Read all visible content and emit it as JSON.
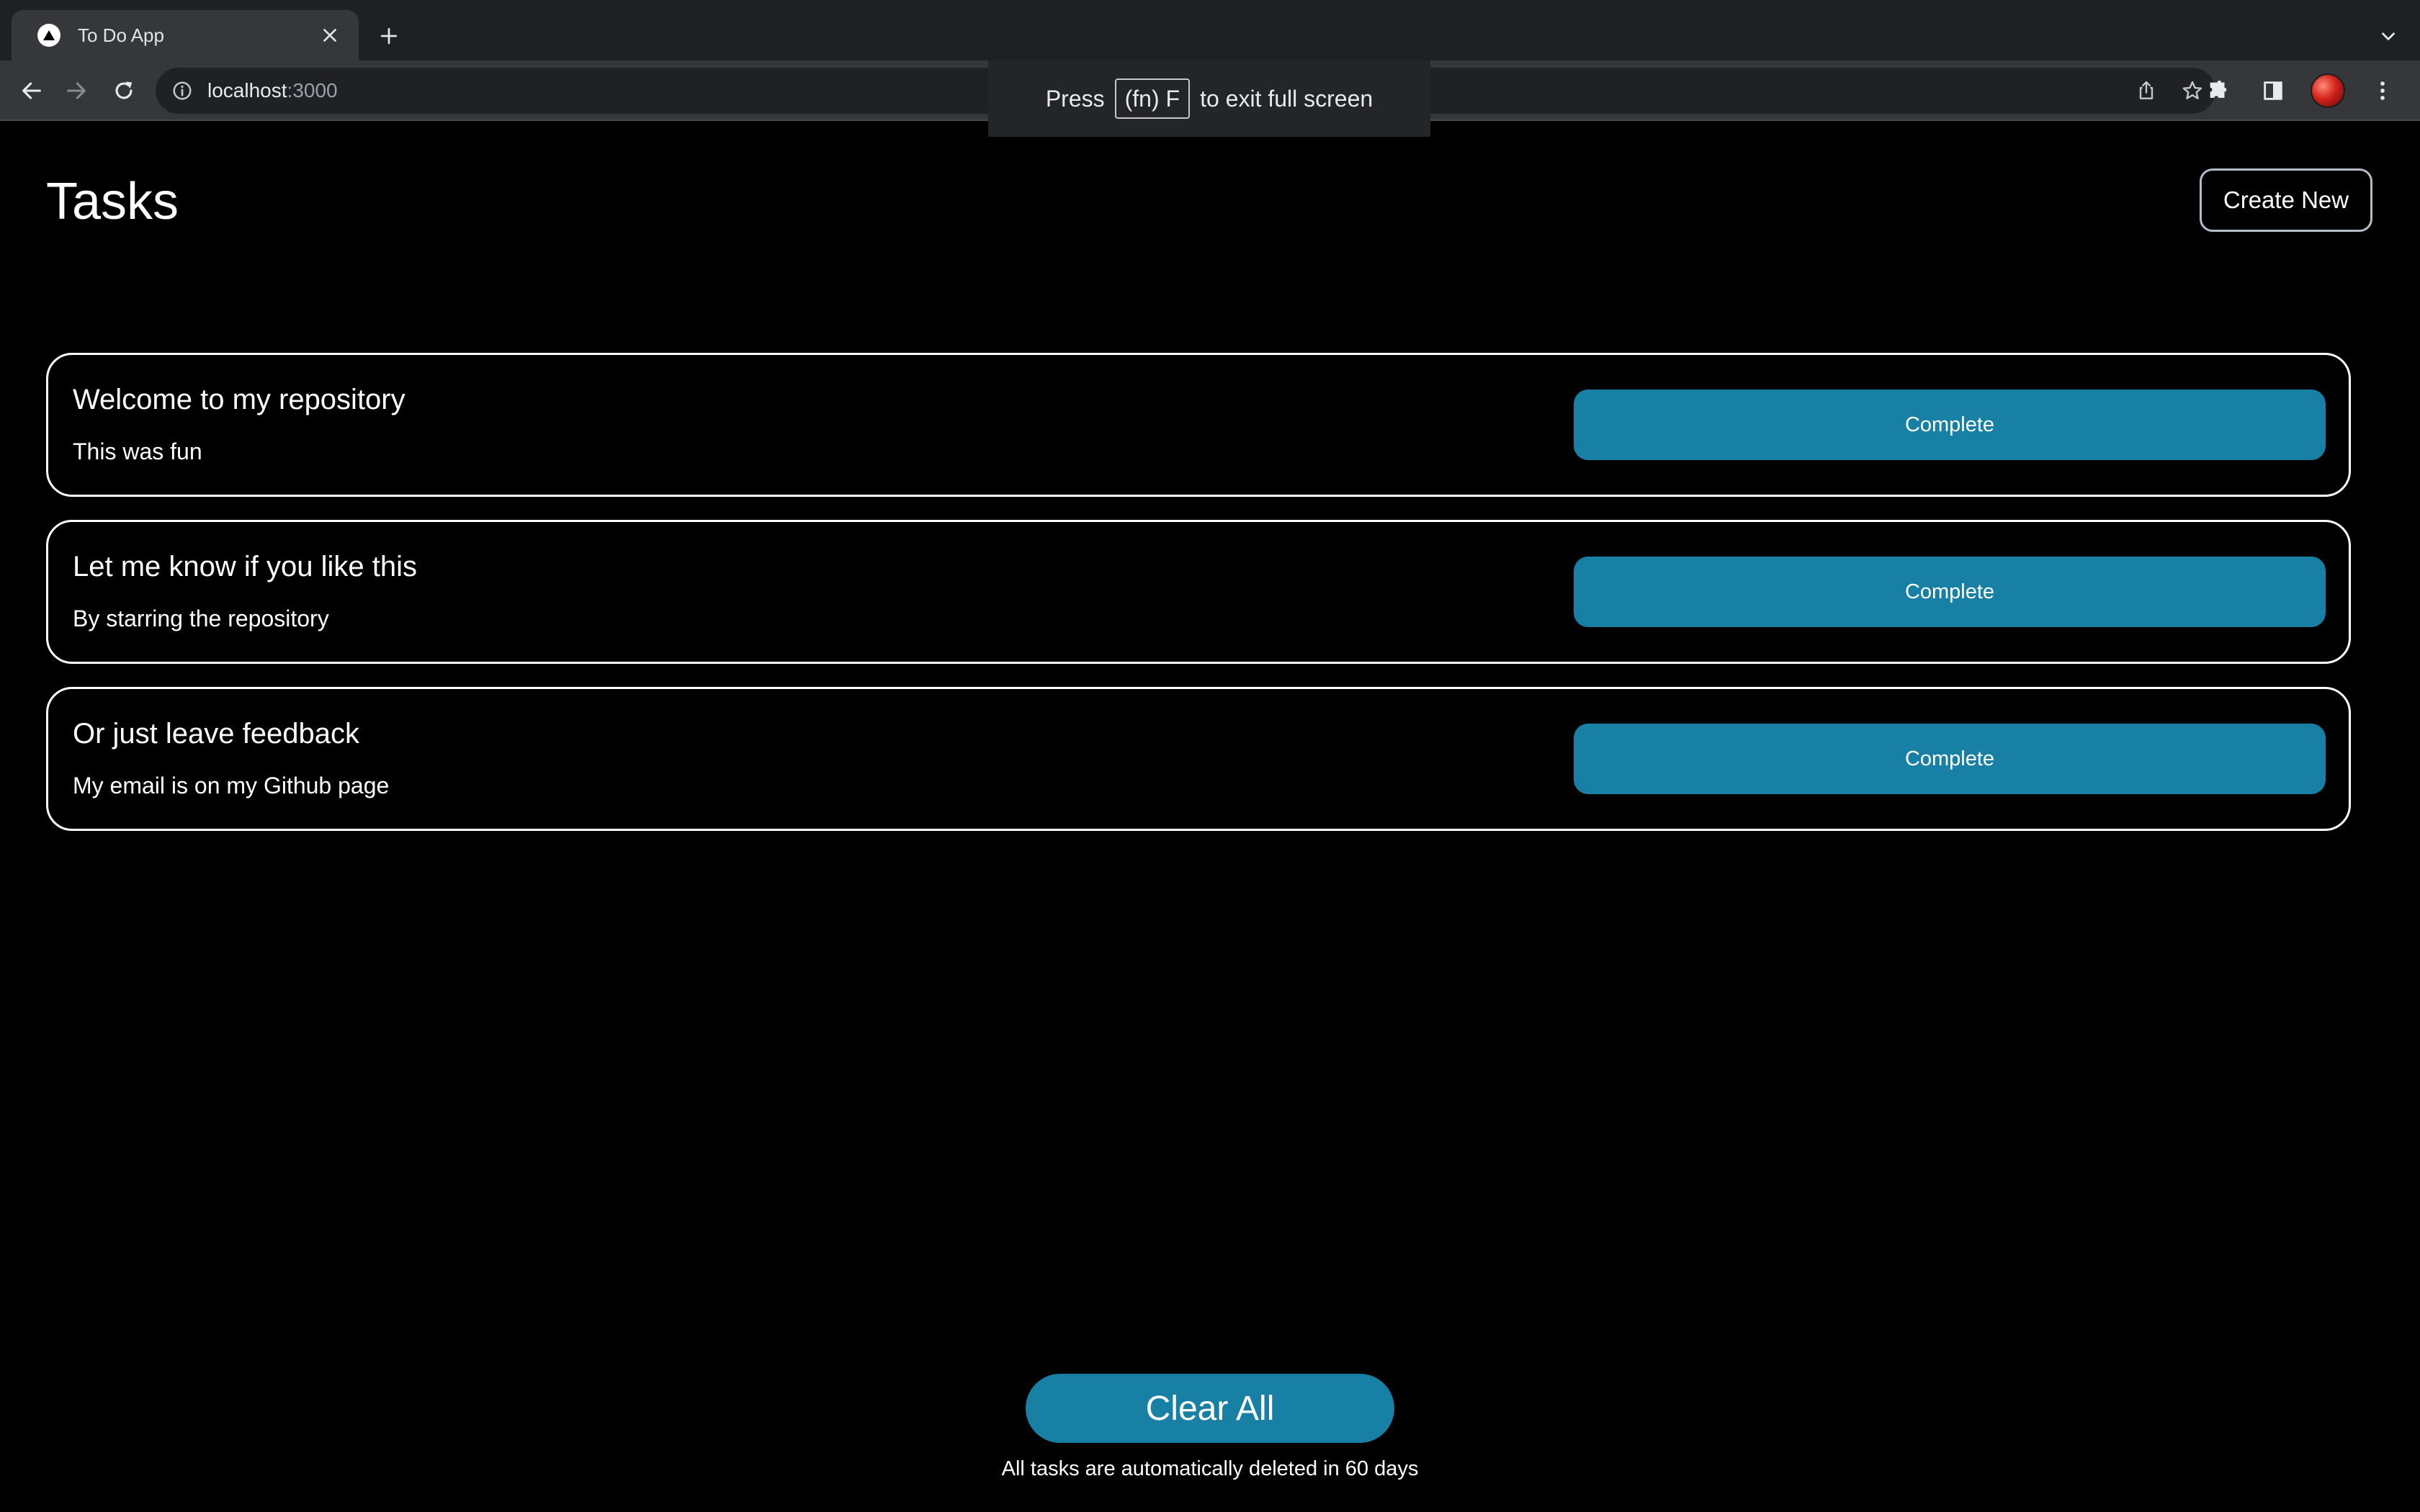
{
  "browser": {
    "tab_title": "To Do App",
    "url_host": "localhost",
    "url_port": ":3000",
    "icons": {
      "favicon": "triangle-logo-icon",
      "tab_close": "close-icon",
      "new_tab": "plus-icon",
      "tab_search": "chevron-down-icon",
      "back": "back-arrow-icon",
      "forward": "forward-arrow-icon",
      "reload": "reload-icon",
      "site_info": "info-icon",
      "share": "share-icon",
      "bookmark": "star-icon",
      "extensions": "puzzle-icon",
      "side_panel": "side-panel-icon",
      "menu": "kebab-menu-icon"
    }
  },
  "fullscreen_banner": {
    "before": "Press",
    "key": "(fn) F",
    "after": "to exit full screen"
  },
  "page": {
    "title": "Tasks",
    "create_button": "Create New",
    "tasks": [
      {
        "title": "Welcome to my repository",
        "description": "This was fun",
        "action": "Complete"
      },
      {
        "title": "Let me know if you like this",
        "description": "By starring the repository",
        "action": "Complete"
      },
      {
        "title": "Or just leave feedback",
        "description": "My email is on my Github page",
        "action": "Complete"
      }
    ],
    "clear_button": "Clear All",
    "footer_note": "All tasks are automatically deleted in 60 days"
  },
  "colors": {
    "background": "#000000",
    "accent": "#1880a5",
    "chrome_tabstrip": "#1f2023",
    "chrome_toolbar": "#36373a"
  }
}
